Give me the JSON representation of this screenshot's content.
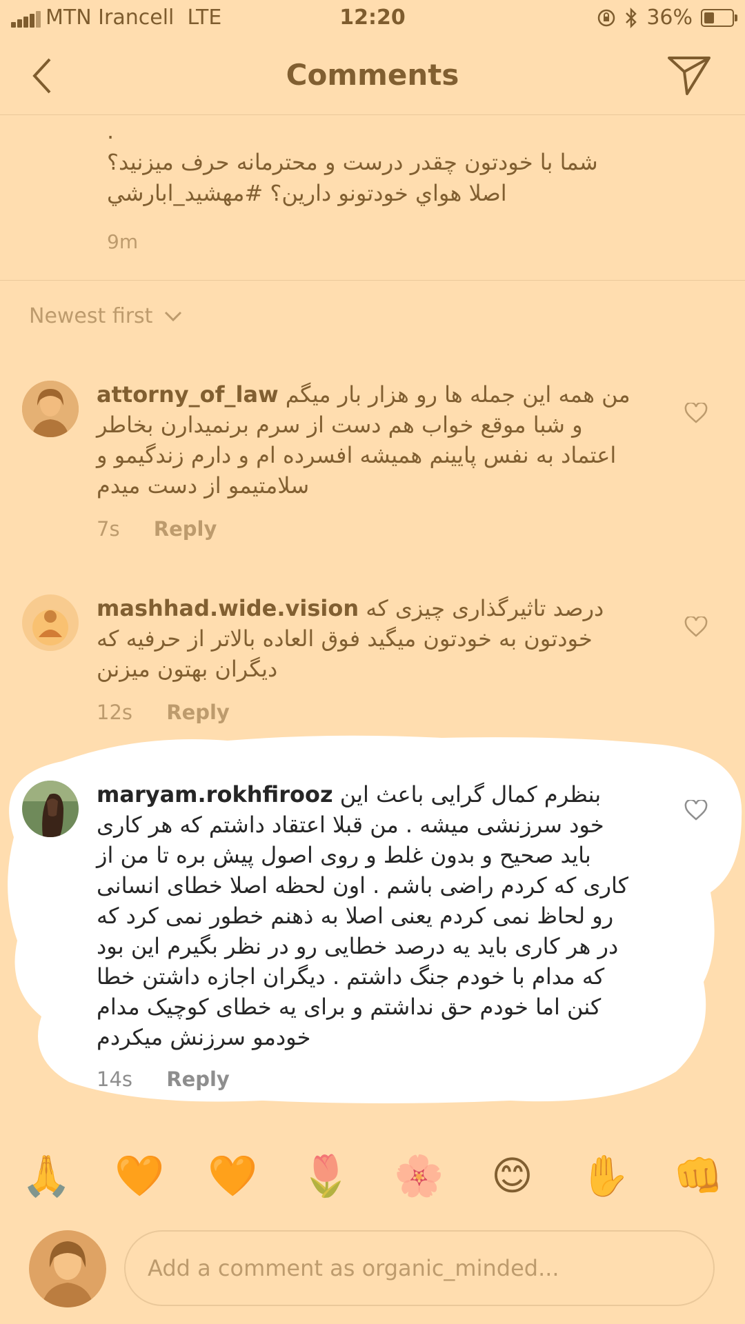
{
  "status_bar": {
    "carrier": "MTN Irancell",
    "network": "LTE",
    "time": "12:20",
    "battery_percent": "36%",
    "battery_level": 0.36
  },
  "nav": {
    "title": "Comments",
    "back_icon": "chevron-left-icon",
    "send_icon": "paper-plane-icon"
  },
  "caption": {
    "line0": ".",
    "line1": "شما با خودتون چقدر درست و محترمانه حرف میزنید؟",
    "line2": "اصلا هواي خودتونو دارين؟ #مهشيد_ابارشي",
    "time": "9m"
  },
  "sort": {
    "label": "Newest first"
  },
  "comments": [
    {
      "username": "attorny_of_law",
      "text": "من همه این جمله ها رو هزار بار میگم و شبا موقع خواب هم دست از سرم برنمیدارن بخاطر اعتماد به نفس پایینم همیشه افسرده ام و دارم زندگیمو و سلامتیمو از دست میدم",
      "time": "7s",
      "reply": "Reply"
    },
    {
      "username": "mashhad.wide.vision",
      "text": "درصد تاثیرگذاری چیزی که خودتون به خودتون میگید فوق العاده بالاتر از حرفیه که دیگران بهتون میزنن",
      "time": "12s",
      "reply": "Reply"
    },
    {
      "username": "maryam.rokhfirooz",
      "text": "بنظرم کمال گرایی باعث این خود سرزنشی میشه . من قبلا اعتقاد داشتم که هر کاری باید صحیح و بدون غلط و روی اصول پیش بره تا من از کاری که کردم راضی باشم . اون لحظه اصلا خطای انسانی رو لحاظ نمی کردم یعنی اصلا به ذهنم خطور نمی کرد که در هر کاری باید یه درصد خطایی رو در نظر بگیرم این بود که مدام با خودم جنگ داشتم . دیگران اجازه داشتن خطا کنن اما خودم حق نداشتم و برای یه خطای کوچیک مدام خودمو سرزنش میکردم",
      "time": "14s",
      "reply": "Reply"
    }
  ],
  "emoji_bar": [
    "🙏",
    "🧡",
    "🧡",
    "🌷",
    "🌸",
    "😊",
    "✋",
    "👊"
  ],
  "composer": {
    "placeholder": "Add a comment as organic_minded..."
  },
  "colors": {
    "overlay": "#ffae40",
    "secondary_text": "#8e8e8e"
  }
}
